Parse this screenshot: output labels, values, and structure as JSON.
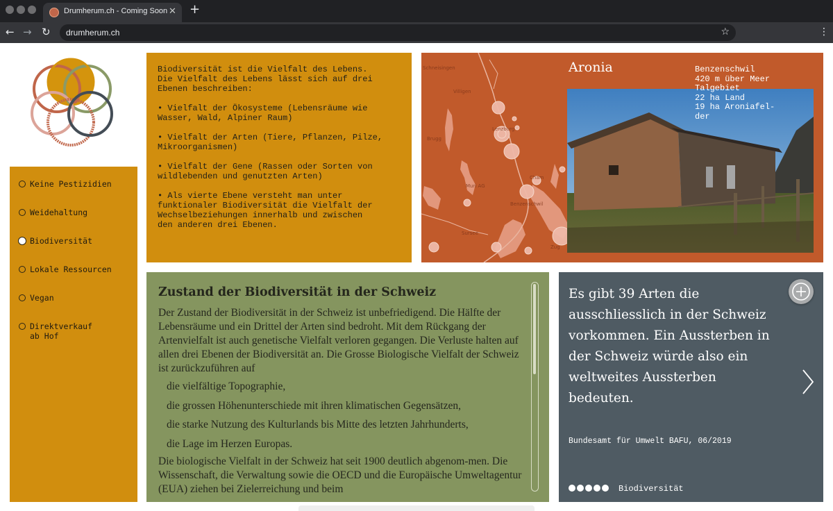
{
  "browser": {
    "tab_title": "Drumherum.ch - Coming Soon",
    "tab_close": "✕",
    "new_tab": "+",
    "url": "drumherum.ch",
    "back": "←",
    "forward": "→",
    "reload": "↻",
    "bookmark": "☆",
    "menu": "⋮"
  },
  "sidebar": {
    "items": [
      {
        "label": "Keine Pestizidien",
        "active": false
      },
      {
        "label": "Weidehaltung",
        "active": false
      },
      {
        "label": "Biodiversität",
        "active": true
      },
      {
        "label": "Lokale Ressourcen",
        "active": false
      },
      {
        "label": "Vegan",
        "active": false
      },
      {
        "label": "Direktverkauf\nab Hof",
        "active": false
      }
    ]
  },
  "bio_panel": {
    "text": "Biodiversität ist die Vielfalt des Lebens.\nDie Vielfalt des Lebens lässt sich auf drei\nEbenen beschreiben:\n\n• Vielfalt der Ökosysteme (Lebensräume wie\nWasser, Wald, Alpiner Raum)\n\n• Vielfalt der Arten (Tiere, Pflanzen, Pilze,\nMikroorganismen)\n\n• Vielfalt der Gene (Rassen oder Sorten von\nwildlebenden und genutzten Arten)\n\n• Als vierte Ebene versteht man unter\nfunktionaler Biodiversität die Vielfalt der\nWechselbeziehungen innerhalb und zwischen\nden anderen drei Ebenen."
  },
  "map_panel": {
    "title": "Aronia",
    "info": "Benzenschwil\n420 m über Meer\nTalgebiet\n22 ha Land\n19 ha Aroniafel-\nder"
  },
  "state_panel": {
    "title": "Zustand der Biodiversität in der Schweiz",
    "intro": "Der Zustand der Biodiversität in der Schweiz ist unbefriedigend. Die Hälfte der Lebensräume und ein Drittel der Arten sind bedroht. Mit dem Rückgang der Artenvielfalt ist auch genetische Vielfalt verloren gegangen. Die Verluste halten auf allen drei Ebenen der Biodiversität an. Die Grosse Biologische Vielfalt der Schweiz ist zurückzuführen auf",
    "list": [
      "die vielfältige Topographie,",
      "die grossen Höhenunterschiede mit ihren klimatischen Gegensätzen,",
      "die starke Nutzung des Kulturlands bis Mitte des letzten Jahrhunderts,",
      "die Lage im Herzen Europas."
    ],
    "outro": "Die biologische Vielfalt in der Schweiz hat seit 1900 deutlich abgenom-men. Die Wissenschaft, die Verwaltung sowie die OECD und die Europäische Umweltagentur (EUA) ziehen bei Zielerreichung und beim"
  },
  "quote_panel": {
    "quote": "Es gibt 39 Arten die ausschliesslich in der Schweiz vorkommen. Ein Aussterben in der Schweiz würde also ein weltweites Aussterben bedeuten.",
    "source": "Bundesamt für Umwelt BAFU, 06/2019",
    "slide_label": "Biodiversität",
    "slide_count": 5
  },
  "colors": {
    "mustard": "#d18e0e",
    "rust": "#c15a2b",
    "olive": "#85955f",
    "slate": "#4f5b63"
  }
}
